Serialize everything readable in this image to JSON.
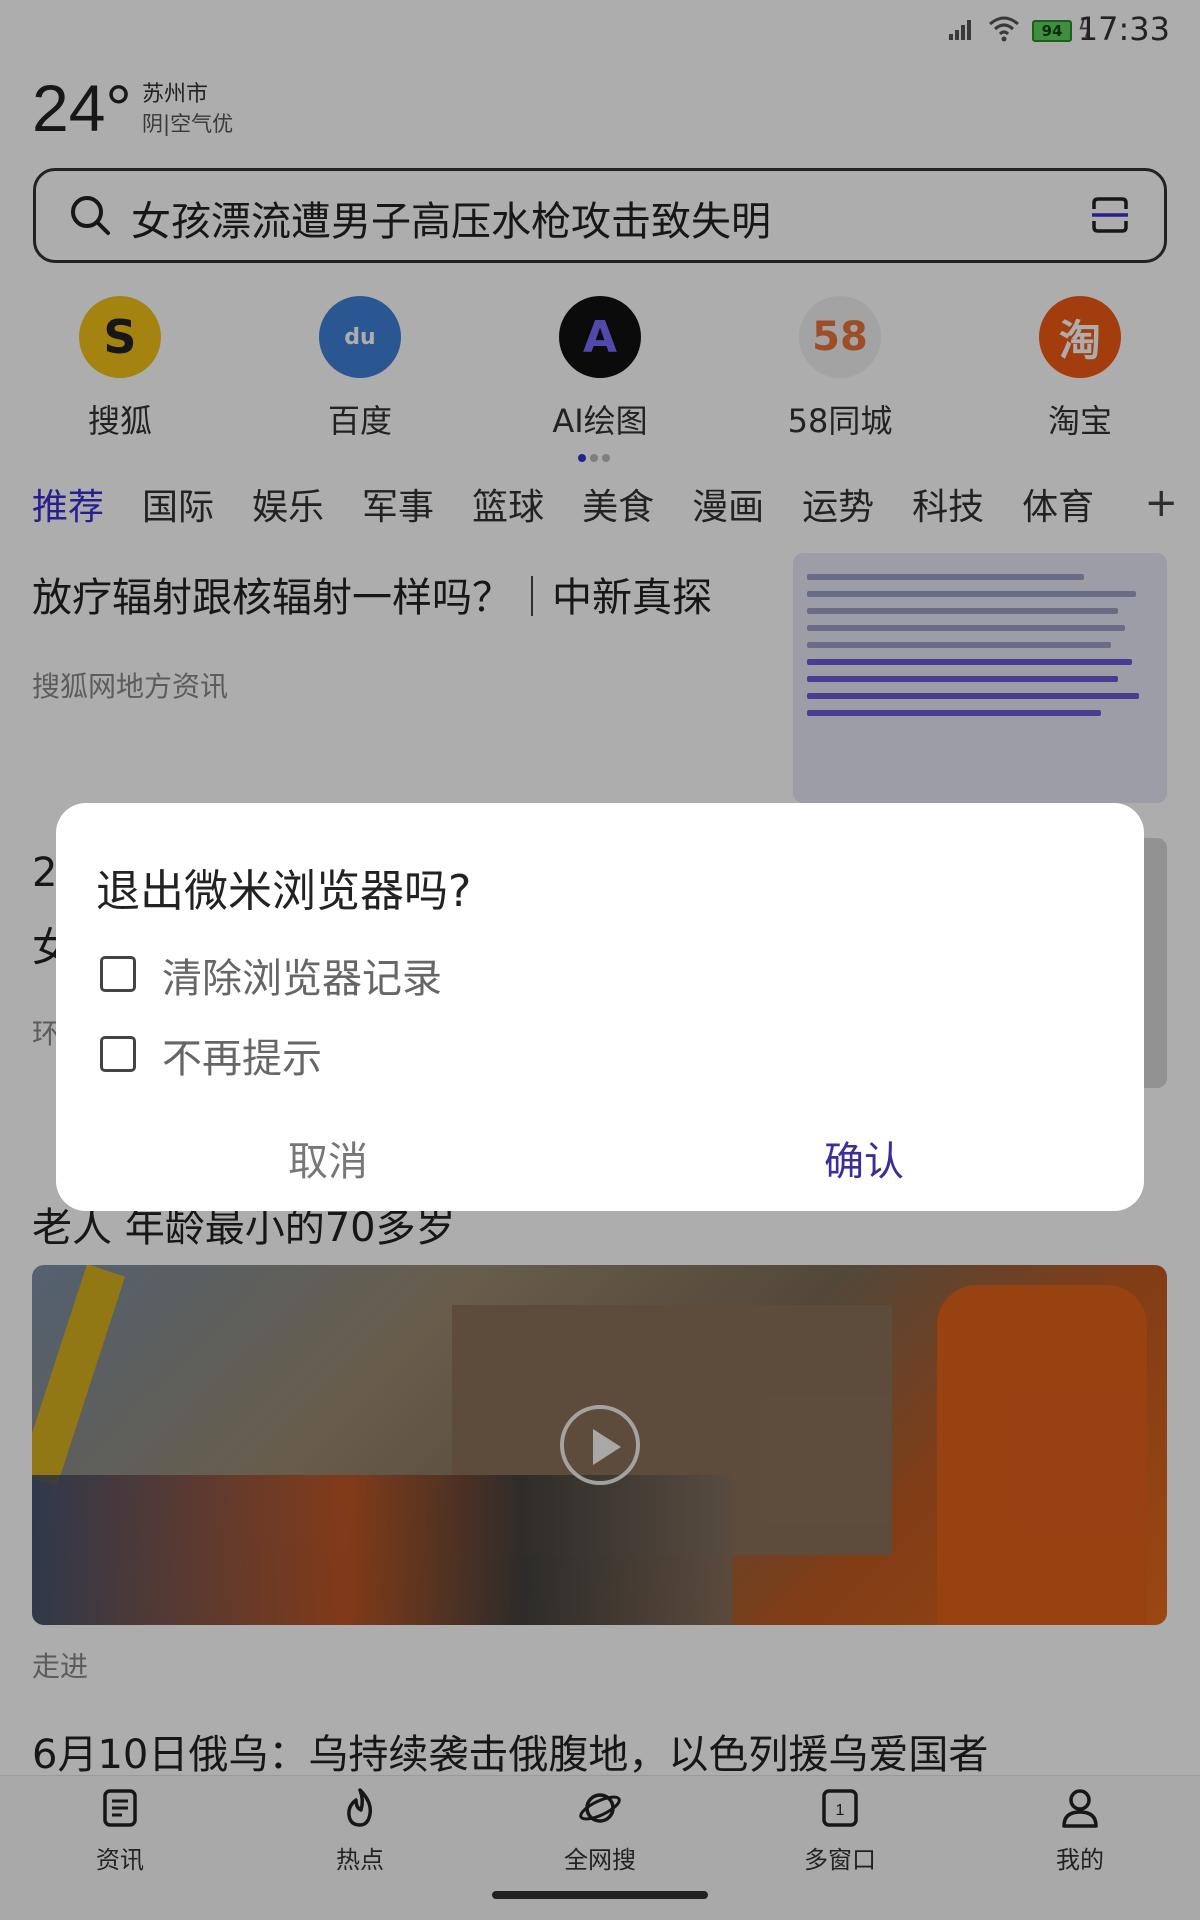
{
  "status_bar": {
    "time": "17:33",
    "battery": "94"
  },
  "weather": {
    "temperature": "24°",
    "city": "苏州市",
    "condition": "阴|空气优"
  },
  "search": {
    "query": "女孩漂流遭男子高压水枪攻击致失明"
  },
  "quick_links": [
    {
      "label": "搜狐",
      "icon": "sohu-logo-icon",
      "bg": "#f2c21a"
    },
    {
      "label": "百度",
      "icon": "baidu-paw-icon",
      "bg": "#3e7fd8"
    },
    {
      "label": "AI绘图",
      "icon": "ai-draw-icon",
      "bg": "#111111"
    },
    {
      "label": "58同城",
      "icon": "58-logo-icon",
      "bg": "#f1f1f1"
    },
    {
      "label": "淘宝",
      "icon": "taobao-logo-icon",
      "bg": "#f05a14"
    }
  ],
  "tabs": [
    "推荐",
    "国际",
    "娱乐",
    "军事",
    "篮球",
    "美食",
    "漫画",
    "运势",
    "科技",
    "体育"
  ],
  "feed": [
    {
      "title": "放疗辐射跟核辐射一样吗？｜中新真探",
      "source": "搜狐网地方资讯"
    },
    {
      "title": "2",
      "title2": "女",
      "source": "环"
    },
    {
      "title": "老人 年龄最小的70多岁"
    },
    {
      "source": "走进"
    },
    {
      "title": "6月10日俄乌：乌持续袭击俄腹地，以色列援乌爱国者"
    }
  ],
  "bottom_nav": [
    {
      "label": "资讯",
      "icon": "news-icon"
    },
    {
      "label": "热点",
      "icon": "flame-icon"
    },
    {
      "label": "全网搜",
      "icon": "planet-icon"
    },
    {
      "label": "多窗口",
      "icon": "windows-icon",
      "count": "1"
    },
    {
      "label": "我的",
      "icon": "profile-icon"
    }
  ],
  "dialog": {
    "title": "退出微米浏览器吗?",
    "options": [
      {
        "label": "清除浏览器记录",
        "checked": false
      },
      {
        "label": "不再提示",
        "checked": false
      }
    ],
    "cancel_label": "取消",
    "confirm_label": "确认"
  },
  "colors": {
    "accent": "#3a2fd0",
    "confirm": "#3a2f9a"
  }
}
